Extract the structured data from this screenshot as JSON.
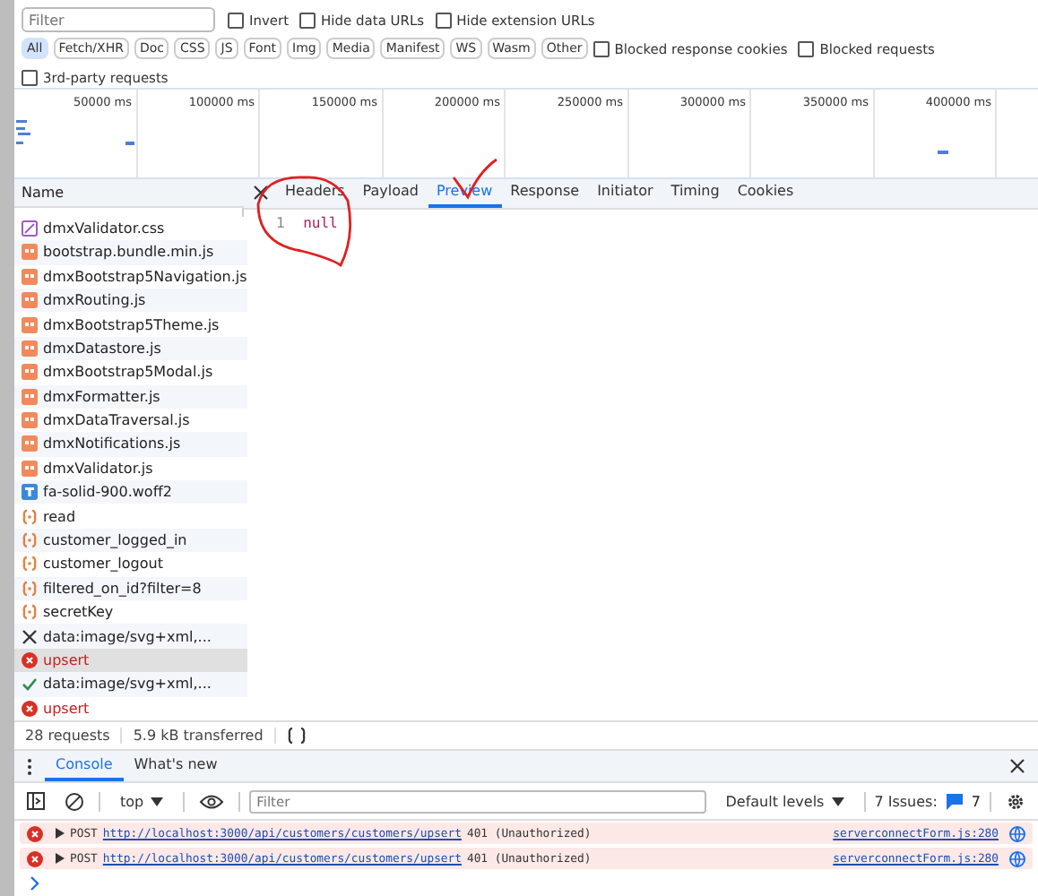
{
  "filter": {
    "placeholder": "Filter"
  },
  "top_checkboxes": [
    {
      "label": "Invert",
      "checked": false
    },
    {
      "label": "Hide data URLs",
      "checked": false
    },
    {
      "label": "Hide extension URLs",
      "checked": false
    }
  ],
  "type_filters": [
    {
      "label": "All",
      "selected": true
    },
    {
      "label": "Fetch/XHR",
      "selected": false
    },
    {
      "label": "Doc",
      "selected": false
    },
    {
      "label": "CSS",
      "selected": false
    },
    {
      "label": "JS",
      "selected": false
    },
    {
      "label": "Font",
      "selected": false
    },
    {
      "label": "Img",
      "selected": false
    },
    {
      "label": "Media",
      "selected": false
    },
    {
      "label": "Manifest",
      "selected": false
    },
    {
      "label": "WS",
      "selected": false
    },
    {
      "label": "Wasm",
      "selected": false
    },
    {
      "label": "Other",
      "selected": false
    }
  ],
  "extra_checkboxes": [
    {
      "label": "Blocked response cookies",
      "checked": false
    },
    {
      "label": "Blocked requests",
      "checked": false
    },
    {
      "label": "3rd-party requests",
      "checked": false
    }
  ],
  "timeline_ticks": [
    "50000 ms",
    "100000 ms",
    "150000 ms",
    "200000 ms",
    "250000 ms",
    "300000 ms",
    "350000 ms",
    "400000 ms"
  ],
  "requests": {
    "header": "Name",
    "rows": [
      {
        "name": "dmxValidator.css",
        "kind": "css",
        "selected": false
      },
      {
        "name": "bootstrap.bundle.min.js",
        "kind": "js",
        "selected": false
      },
      {
        "name": "dmxBootstrap5Navigation.js",
        "kind": "js",
        "selected": false
      },
      {
        "name": "dmxRouting.js",
        "kind": "js",
        "selected": false
      },
      {
        "name": "dmxBootstrap5Theme.js",
        "kind": "js",
        "selected": false
      },
      {
        "name": "dmxDatastore.js",
        "kind": "js",
        "selected": false
      },
      {
        "name": "dmxBootstrap5Modal.js",
        "kind": "js",
        "selected": false
      },
      {
        "name": "dmxFormatter.js",
        "kind": "js",
        "selected": false
      },
      {
        "name": "dmxDataTraversal.js",
        "kind": "js",
        "selected": false
      },
      {
        "name": "dmxNotifications.js",
        "kind": "js",
        "selected": false
      },
      {
        "name": "dmxValidator.js",
        "kind": "js",
        "selected": false
      },
      {
        "name": "fa-solid-900.woff2",
        "kind": "font",
        "selected": false
      },
      {
        "name": "read",
        "kind": "xhr",
        "selected": false
      },
      {
        "name": "customer_logged_in",
        "kind": "xhr",
        "selected": false
      },
      {
        "name": "customer_logout",
        "kind": "xhr",
        "selected": false
      },
      {
        "name": "filtered_on_id?filter=8",
        "kind": "xhr",
        "selected": false
      },
      {
        "name": "secretKey",
        "kind": "xhr",
        "selected": false
      },
      {
        "name": "data:image/svg+xml,...",
        "kind": "failed",
        "selected": false
      },
      {
        "name": "upsert",
        "kind": "error",
        "selected": true
      },
      {
        "name": "data:image/svg+xml,...",
        "kind": "ok",
        "selected": false
      },
      {
        "name": "upsert",
        "kind": "error",
        "selected": false
      }
    ]
  },
  "detail_tabs": [
    {
      "label": "Headers",
      "selected": false
    },
    {
      "label": "Payload",
      "selected": false
    },
    {
      "label": "Preview",
      "selected": true
    },
    {
      "label": "Response",
      "selected": false
    },
    {
      "label": "Initiator",
      "selected": false
    },
    {
      "label": "Timing",
      "selected": false
    },
    {
      "label": "Cookies",
      "selected": false
    }
  ],
  "preview": [
    {
      "line": "1",
      "text": "null"
    }
  ],
  "summary": [
    "28 requests",
    "5.9 kB transferred"
  ],
  "drawer_tabs": [
    {
      "label": "Console",
      "selected": true
    },
    {
      "label": "What's new",
      "selected": false
    }
  ],
  "console_toolbar": {
    "context": "top",
    "filter_placeholder": "Filter",
    "levels": "Default levels",
    "issues": "7 Issues:",
    "issues_count": "7"
  },
  "messages": [
    {
      "method": "POST",
      "url": "http://localhost:3000/api/customers/customers/upsert",
      "status": "401 (Unauthorized)",
      "source": "serverconnectForm.js:280"
    },
    {
      "method": "POST",
      "url": "http://localhost:3000/api/customers/customers/upsert",
      "status": "401 (Unauthorized)",
      "source": "serverconnectForm.js:280"
    }
  ]
}
